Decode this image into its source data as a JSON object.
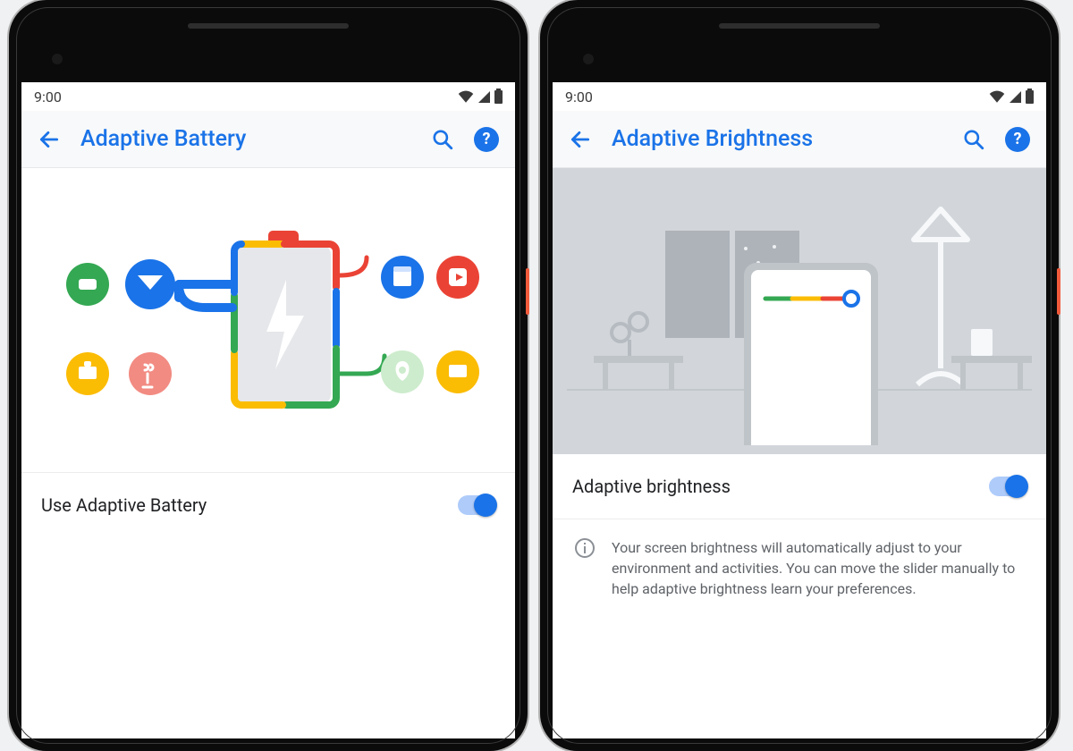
{
  "status": {
    "time": "9:00"
  },
  "left": {
    "title": "Adaptive Battery",
    "row_label": "Use Adaptive Battery",
    "toggle_on": true
  },
  "right": {
    "title": "Adaptive Brightness",
    "row_label": "Adaptive brightness",
    "toggle_on": true,
    "info": "Your screen brightness will automatically adjust to your environment and activities. You can move the slider manually to help adaptive brightness learn your preferences."
  },
  "colors": {
    "google_blue": "#1a73e8",
    "google_red": "#ea4335",
    "google_yellow": "#fbbc04",
    "google_green": "#34a853"
  }
}
